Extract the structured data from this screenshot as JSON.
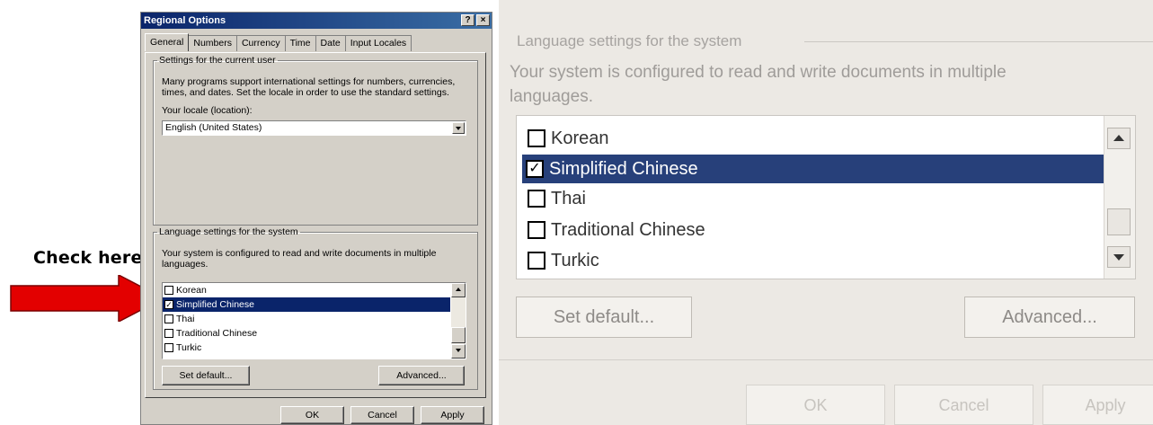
{
  "callout": {
    "text": "Check here",
    "arrow_color": "#e30000"
  },
  "dialog": {
    "title": "Regional Options",
    "help_btn": "?",
    "close_btn": "×",
    "tabs": [
      "General",
      "Numbers",
      "Currency",
      "Time",
      "Date",
      "Input Locales"
    ],
    "user_group": {
      "legend": "Settings for the current user",
      "desc": "Many programs support international settings for numbers, currencies, times, and dates. Set the locale in order to use the standard settings.",
      "locale_label": "Your locale (location):",
      "locale_value": "English (United States)"
    },
    "system_group": {
      "legend": "Language settings for the system",
      "desc": "Your system is configured to read and write documents in multiple languages.",
      "languages": [
        {
          "label": "Korean",
          "checked": false,
          "selected": false
        },
        {
          "label": "Simplified Chinese",
          "checked": true,
          "selected": true
        },
        {
          "label": "Thai",
          "checked": false,
          "selected": false
        },
        {
          "label": "Traditional Chinese",
          "checked": false,
          "selected": false
        },
        {
          "label": "Turkic",
          "checked": false,
          "selected": false
        }
      ],
      "set_default": "Set default...",
      "advanced": "Advanced..."
    },
    "ok": "OK",
    "cancel": "Cancel",
    "apply": "Apply"
  },
  "zoom": {
    "legend": "Language settings for the system",
    "desc": "Your system is configured to read and write documents in multiple languages.",
    "languages": [
      {
        "label": "Korean",
        "checked": false,
        "selected": false
      },
      {
        "label": "Simplified Chinese",
        "checked": true,
        "selected": true
      },
      {
        "label": "Thai",
        "checked": false,
        "selected": false
      },
      {
        "label": "Traditional Chinese",
        "checked": false,
        "selected": false
      },
      {
        "label": "Turkic",
        "checked": false,
        "selected": false
      }
    ],
    "set_default": "Set default...",
    "advanced": "Advanced...",
    "ok": "OK",
    "cancel": "Cancel",
    "apply": "Apply"
  }
}
